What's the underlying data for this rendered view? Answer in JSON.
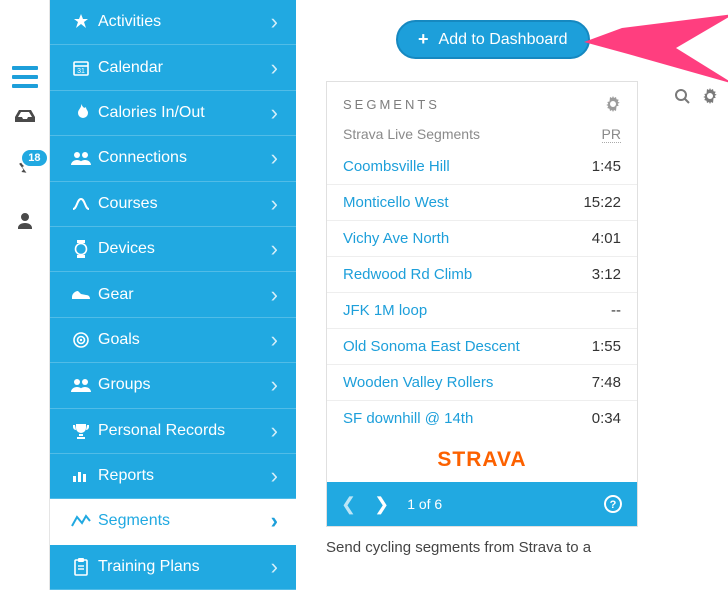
{
  "rail": {
    "badge": "18"
  },
  "sidebar": {
    "items": [
      {
        "label": "Activities",
        "icon": "activities",
        "active": false
      },
      {
        "label": "Calendar",
        "icon": "calendar",
        "active": false
      },
      {
        "label": "Calories In/Out",
        "icon": "flame",
        "active": false
      },
      {
        "label": "Connections",
        "icon": "people",
        "active": false
      },
      {
        "label": "Courses",
        "icon": "route",
        "active": false
      },
      {
        "label": "Devices",
        "icon": "watch",
        "active": false
      },
      {
        "label": "Gear",
        "icon": "shoe",
        "active": false
      },
      {
        "label": "Goals",
        "icon": "target",
        "active": false
      },
      {
        "label": "Groups",
        "icon": "people",
        "active": false
      },
      {
        "label": "Personal Records",
        "icon": "trophy",
        "active": false
      },
      {
        "label": "Reports",
        "icon": "chart",
        "active": false
      },
      {
        "label": "Segments",
        "icon": "segments",
        "active": true
      },
      {
        "label": "Training Plans",
        "icon": "clipboard",
        "active": false
      }
    ]
  },
  "add_button": {
    "label": "Add to Dashboard"
  },
  "widget": {
    "title": "SEGMENTS",
    "subtitle": "Strava Live Segments",
    "pr_label": "PR",
    "brand": "STRAVA",
    "pager": "1 of 6",
    "segments": [
      {
        "name": "Coombsville Hill",
        "time": "1:45"
      },
      {
        "name": "Monticello West",
        "time": "15:22"
      },
      {
        "name": "Vichy Ave North",
        "time": "4:01"
      },
      {
        "name": "Redwood Rd Climb",
        "time": "3:12"
      },
      {
        "name": "JFK 1M loop",
        "time": "--"
      },
      {
        "name": "Old Sonoma East Descent",
        "time": "1:55"
      },
      {
        "name": "Wooden Valley Rollers",
        "time": "7:48"
      },
      {
        "name": "SF downhill @ 14th",
        "time": "0:34"
      }
    ]
  },
  "caption": "Send cycling segments from Strava to a"
}
